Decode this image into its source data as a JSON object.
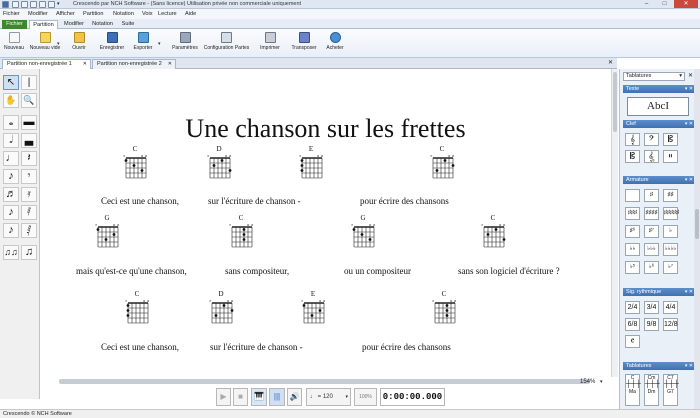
{
  "window": {
    "title": "Crescendo par NCH Software - (Sans licence) Utilisation privée non commerciale uniquement",
    "controls": [
      "–",
      "□",
      "✕"
    ]
  },
  "menu": [
    "Fichier",
    "Modifier",
    "Afficher",
    "Partition",
    "Notation",
    "Voix",
    "Lecture",
    "Aide"
  ],
  "ribbon_tabs": [
    "Fichier",
    "Partition",
    "Modifier",
    "Notation",
    "Suite"
  ],
  "toolbar": [
    {
      "label": "Nouveau",
      "icon": "new-file-icon"
    },
    {
      "label": "Nouveau vide",
      "icon": "new-blank-icon"
    },
    {
      "label": "Ouvrir",
      "icon": "open-folder-icon"
    },
    {
      "label": "Enregistrer",
      "icon": "save-icon"
    },
    {
      "label": "Exporter",
      "icon": "export-icon"
    },
    {
      "label": "Paramètres",
      "icon": "settings-icon"
    },
    {
      "label": "Configuration Partes",
      "icon": "parts-config-icon"
    },
    {
      "label": "Imprimer",
      "icon": "print-icon"
    },
    {
      "label": "Transposer",
      "icon": "transpose-icon"
    },
    {
      "label": "Acheter",
      "icon": "buy-icon"
    }
  ],
  "doc_tabs": [
    {
      "label": "Partition non-enregistrée 1",
      "close": "✕"
    },
    {
      "label": "Partition non-enregistrée 2",
      "close": "✕"
    }
  ],
  "score": {
    "title": "Une chanson sur les frettes",
    "chords": [
      "C",
      "D",
      "E",
      "C",
      "G",
      "C",
      "G",
      "C",
      "C",
      "D",
      "E",
      "C"
    ],
    "lyrics": [
      "Ceci est une chanson,",
      "sur l'écriture de chanson  -",
      "pour écrire des chansons",
      "mais qu'est-ce qu'une chanson,",
      "sans compositeur,",
      "ou un compositeur",
      "sans son logiciel d'écriture ?",
      "Ceci est une chanson,",
      "sur l'écriture de chanson  -",
      "pour écrire des chansons"
    ]
  },
  "right_panel": {
    "dropdown": "Tablatures",
    "sections": {
      "texte": "Texte",
      "texte_tile": "AbcI",
      "clef": "Clef",
      "armature": "Armature",
      "rythmique": "Sig. rythmique",
      "tablatures": "Tablatures"
    },
    "tab_chords": [
      "C",
      "Cm",
      "C7"
    ],
    "tab_chord_subs": [
      "Ma",
      "Dm",
      "G7"
    ]
  },
  "transport": {
    "tempo": "♩ = 120",
    "zoom_small": "100%",
    "time": "0:00:00.000"
  },
  "zoom": "154%",
  "status": "Crescendo  © NCH Software",
  "colors": {
    "accent": "#3f70b0",
    "file_tab": "#3a8a2c",
    "ribbon_bg": "#e6edf6"
  }
}
